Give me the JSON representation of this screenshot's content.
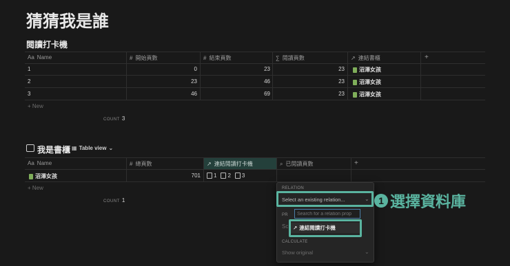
{
  "page": {
    "title": "猜猜我是誰"
  },
  "table1": {
    "title": "閱讀打卡機",
    "headers": [
      "Name",
      "開始頁數",
      "結束頁數",
      "閱讀頁數",
      "連結書櫃"
    ],
    "rows": [
      {
        "name": "1",
        "start": "0",
        "end": "23",
        "read": "23",
        "book": "沼澤女孩"
      },
      {
        "name": "2",
        "start": "23",
        "end": "46",
        "read": "23",
        "book": "沼澤女孩"
      },
      {
        "name": "3",
        "start": "46",
        "end": "69",
        "read": "23",
        "book": "沼澤女孩"
      }
    ],
    "new_label": "New",
    "count_label": "COUNT",
    "count_value": "3"
  },
  "table2": {
    "title": "我是書櫃",
    "view_label": "Table view",
    "headers": [
      "Name",
      "總頁數",
      "連結閱讀打卡機",
      "已閱讀頁數"
    ],
    "row": {
      "name": "沼澤女孩",
      "total": "701",
      "links": [
        "1",
        "2",
        "3"
      ]
    },
    "new_label": "New",
    "count_label": "COUNT",
    "count_value": "1"
  },
  "popup": {
    "relation_label": "RELATION",
    "relation_value": "Select an existing relation...",
    "property_label": "PR",
    "search_placeholder": "Search for a relation prop",
    "option": "連結閱讀打卡機",
    "option_hint": "Sc",
    "calculate_label": "CALCULATE",
    "calculate_value": "Show original"
  },
  "annotation": {
    "step": "1",
    "text": "選擇資料庫"
  },
  "icons": [
    "text-icon",
    "hash-icon",
    "sigma-icon",
    "arrow-up-right-icon",
    "plus-icon",
    "table-icon",
    "search-icon",
    "chevron-down-icon",
    "doc-icon",
    "book-icon"
  ],
  "colors": {
    "accent": "#5ab4a0",
    "background": "#191919",
    "book": "#7fae5a"
  }
}
